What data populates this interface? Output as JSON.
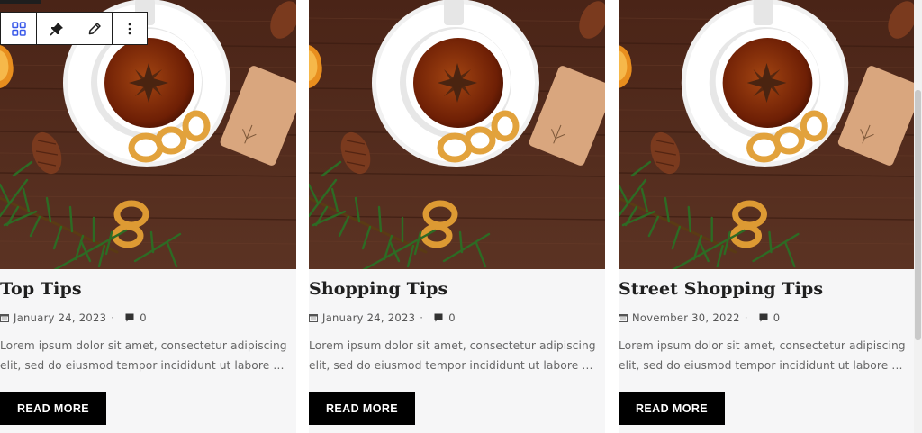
{
  "toolbar": {
    "items": [
      {
        "icon": "grid-view-icon",
        "label": "Block type"
      },
      {
        "icon": "pin-icon",
        "label": "Pin"
      },
      {
        "icon": "pencil-icon",
        "label": "Edit"
      },
      {
        "icon": "more-vertical-icon",
        "label": "Options"
      }
    ],
    "accent": "#3858e9"
  },
  "posts": [
    {
      "title": "Top Tips",
      "date": "January 24, 2023",
      "comments": "0",
      "excerpt": "Lorem ipsum dolor sit amet, consectetur adipiscing elit, sed do eiusmod tempor incididunt ut labore …",
      "button": "READ MORE"
    },
    {
      "title": "Shopping Tips",
      "date": "January 24, 2023",
      "comments": "0",
      "excerpt": "Lorem ipsum dolor sit amet, consectetur adipiscing elit, sed do eiusmod tempor incididunt ut labore …",
      "button": "READ MORE"
    },
    {
      "title": "Street Shopping Tips",
      "date": "November 30, 2022",
      "comments": "0",
      "excerpt": "Lorem ipsum dolor sit amet, consectetur adipiscing elit, sed do eiusmod tempor incididunt ut labore …",
      "button": "READ MORE"
    }
  ],
  "meta_separator": "·",
  "colors": {
    "card_bg": "#f6f6f7",
    "button_bg": "#000000",
    "wood": "#5a3222"
  }
}
